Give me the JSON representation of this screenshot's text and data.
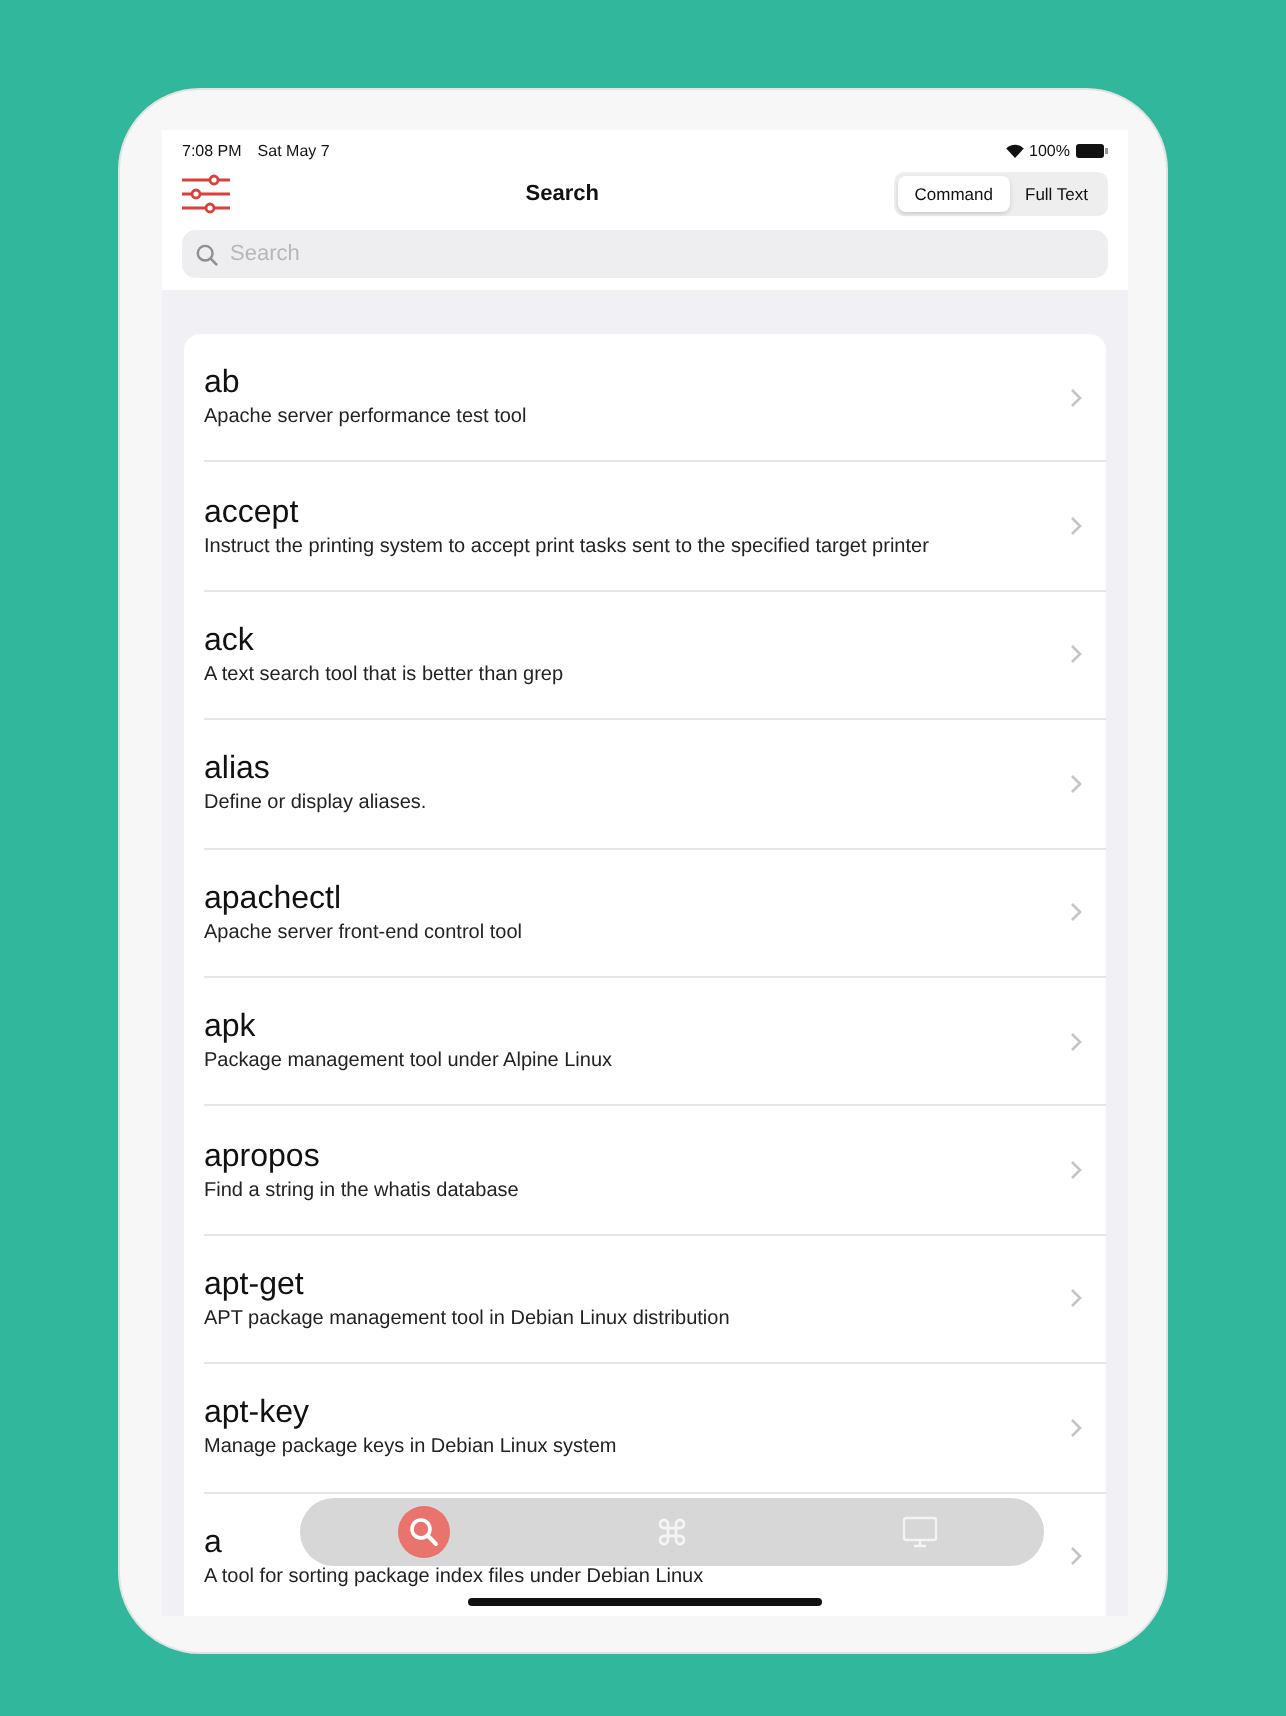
{
  "status_bar": {
    "time": "7:08 PM",
    "date": "Sat May 7",
    "battery": "100%"
  },
  "nav": {
    "title": "Search",
    "segments": [
      {
        "label": "Command",
        "selected": true
      },
      {
        "label": "Full Text",
        "selected": false
      }
    ]
  },
  "search": {
    "placeholder": "Search"
  },
  "commands": [
    {
      "name": "ab",
      "description": "Apache server performance test tool"
    },
    {
      "name": "accept",
      "description": "Instruct the printing system to accept print tasks sent to the specified target printer"
    },
    {
      "name": "ack",
      "description": "A text search tool that is better than grep"
    },
    {
      "name": "alias",
      "description": "Define or display aliases."
    },
    {
      "name": "apachectl",
      "description": "Apache server front-end control tool"
    },
    {
      "name": "apk",
      "description": "Package management tool under Alpine Linux"
    },
    {
      "name": "apropos",
      "description": "Find a string in the whatis database"
    },
    {
      "name": "apt-get",
      "description": "APT package management tool in Debian Linux distribution"
    },
    {
      "name": "apt-key",
      "description": "Manage package keys in Debian Linux system"
    },
    {
      "name": "a",
      "description": "A tool for sorting package index files under Debian Linux"
    }
  ],
  "tab_bar": [
    {
      "kind": "search",
      "selected": true
    },
    {
      "kind": "command",
      "selected": false
    },
    {
      "kind": "display",
      "selected": false
    }
  ]
}
